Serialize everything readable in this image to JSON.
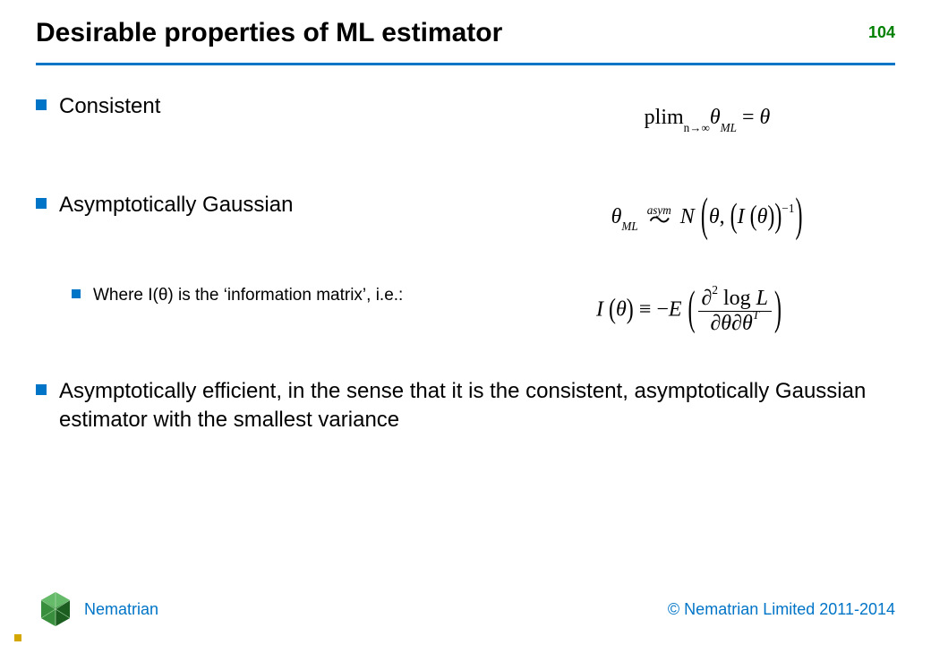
{
  "slide": {
    "number": "104",
    "title": "Desirable properties of ML estimator"
  },
  "bullets": {
    "consistent": "Consistent",
    "asymptotic_gaussian": "Asymptotically Gaussian",
    "info_matrix": "Where I(θ) is the ‘information matrix’, i.e.:",
    "efficient": "Asymptotically efficient, in the sense that it is the consistent, asymptotically Gaussian estimator with the smallest variance"
  },
  "formulas": {
    "f1_plim": "plim",
    "f1_sub": "n→∞",
    "f1_theta": "θ",
    "f1_ml": "ML",
    "f1_eq": " = ",
    "f1_rhs": "θ",
    "f2_theta": "θ",
    "f2_ml": "ML",
    "f2_asym": "asym",
    "f2_tilde": "〜",
    "f2_N": "N",
    "f2_comma": ", ",
    "f2_I": "I",
    "f2_inv": "−1",
    "f3_I": "I",
    "f3_theta": "θ",
    "f3_equiv": " ≡ −",
    "f3_E": "E",
    "f3_partial2": "∂",
    "f3_sq": "2",
    "f3_log": " log ",
    "f3_L": "L",
    "f3_den_a": "∂θ",
    "f3_den_b": "∂θ",
    "f3_T": "T"
  },
  "footer": {
    "brand": "Nematrian",
    "copyright": "© Nematrian Limited 2011-2014"
  }
}
